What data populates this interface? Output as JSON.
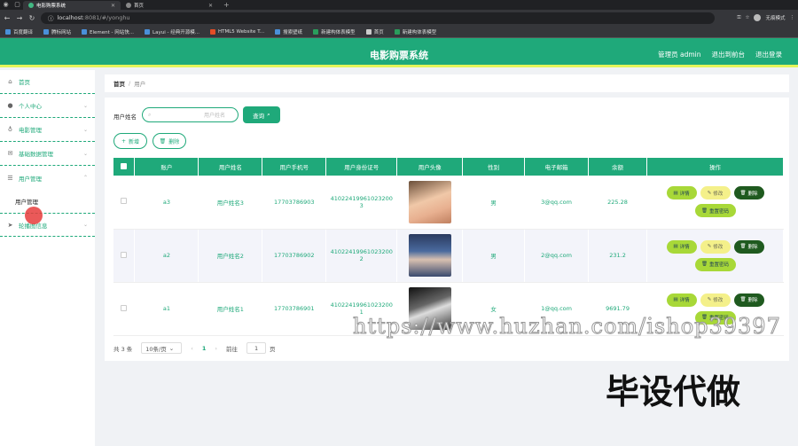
{
  "browser": {
    "tabs": [
      {
        "title": "电影购票系统",
        "active": true
      },
      {
        "title": "首页",
        "active": false
      }
    ],
    "url_host": "localhost",
    "url_rest": ":8081/#/yonghu",
    "profile_label": "无痕模式",
    "bookmarks": [
      "百度翻译",
      "腾标网站",
      "Element - 网站快...",
      "Layui - 经典开源模...",
      "HTML5 Website T...",
      "搜索壁纸",
      "新建构体表模型",
      "首页",
      "新建构体表模型"
    ]
  },
  "header": {
    "title": "电影购票系统",
    "user": "管理员 admin",
    "back_link": "退出到前台",
    "logout": "退出登录"
  },
  "sidebar": {
    "items": [
      {
        "label": "首页",
        "icon": "home-icon"
      },
      {
        "label": "个人中心",
        "icon": "user-icon"
      },
      {
        "label": "电影管理",
        "icon": "bulb-icon"
      },
      {
        "label": "基础数据管理",
        "icon": "mail-icon"
      },
      {
        "label": "用户管理",
        "icon": "menu-icon"
      },
      {
        "label": "用户管理",
        "icon": "",
        "sub": true
      },
      {
        "label": "轮播图信息",
        "icon": "send-icon"
      }
    ]
  },
  "breadcrumb": {
    "home": "首页",
    "sep": "/",
    "current": "用户"
  },
  "search": {
    "label": "用户姓名",
    "placeholder": "用户姓名",
    "query_button": "查询"
  },
  "actions": {
    "add": "新增",
    "delete": "删除"
  },
  "table": {
    "columns": [
      "账户",
      "用户姓名",
      "用户手机号",
      "用户身份证号",
      "用户头像",
      "性别",
      "电子邮箱",
      "余额",
      "操作"
    ],
    "rows": [
      {
        "account": "a3",
        "name": "用户姓名3",
        "phone": "17703786903",
        "id_card": "410224199610232003",
        "gender": "男",
        "email": "3@qq.com",
        "balance": "225.28"
      },
      {
        "account": "a2",
        "name": "用户姓名2",
        "phone": "17703786902",
        "id_card": "410224199610232002",
        "gender": "男",
        "email": "2@qq.com",
        "balance": "231.2"
      },
      {
        "account": "a1",
        "name": "用户姓名1",
        "phone": "17703786901",
        "id_card": "410224199610232001",
        "gender": "女",
        "email": "1@qq.com",
        "balance": "9691.79"
      }
    ],
    "ops": {
      "detail": "详情",
      "edit": "修改",
      "del": "删除",
      "reset": "重置密码"
    }
  },
  "pager": {
    "total": "共 3 条",
    "page_size": "10条/页",
    "current": "1",
    "goto": "前往",
    "goto_value": "1",
    "page_unit": "页"
  },
  "overlay": {
    "watermark": "https://www.huzhan.com/ishop39397",
    "caption": "毕设代做"
  }
}
